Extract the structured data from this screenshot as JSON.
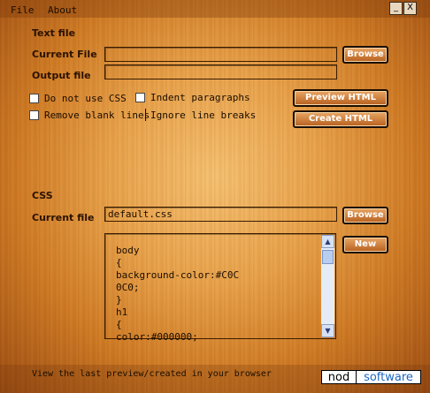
{
  "menu": {
    "file": "File",
    "about": "About"
  },
  "window": {
    "minimize": "_",
    "close": "X"
  },
  "text_file": {
    "section_title": "Text file",
    "current_file_label": "Current File",
    "current_file_value": "",
    "output_file_label": "Output file",
    "output_file_value": "",
    "browse_label": "Browse"
  },
  "options": {
    "no_css": "Do not use CSS",
    "indent": "Indent paragraphs",
    "remove_blank": "Remove blank lines",
    "ignore_breaks": "Ignore line breaks"
  },
  "actions": {
    "preview": "Preview HTML",
    "create": "Create HTML"
  },
  "css": {
    "section_title": "CSS",
    "current_file_label": "Current file",
    "current_file_value": "default.css",
    "browse_label": "Browse",
    "new_label": "New",
    "lines": [
      "body",
      "{",
      "background-color:#C0C",
      "0C0;",
      "}",
      "h1",
      "{",
      "color:#000000;"
    ]
  },
  "status": {
    "text": "View the last preview/created in your browser",
    "brand_left": "nod",
    "brand_right": "software"
  }
}
